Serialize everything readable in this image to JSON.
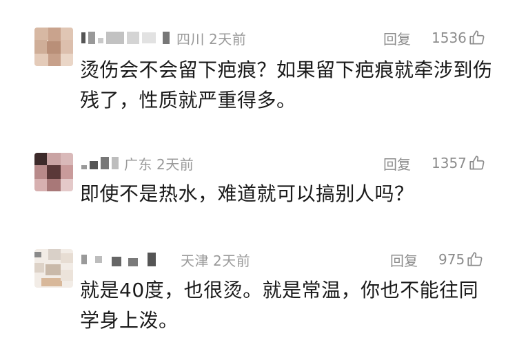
{
  "comments": [
    {
      "location": "四川",
      "time": "2天前",
      "reply_label": "回复",
      "likes": "1536",
      "text": "烫伤会不会留下疤痕？如果留下疤痕就牵涉到伤残了，性质就严重得多。"
    },
    {
      "location": "广东",
      "time": "2天前",
      "reply_label": "回复",
      "likes": "1357",
      "text": "即使不是热水，难道就可以搞别人吗？"
    },
    {
      "location": "天津",
      "time": "2天前",
      "reply_label": "回复",
      "likes": "975",
      "text": "就是40度，也很烫。就是常温，你也不能往同学身上泼。"
    }
  ],
  "icons": {
    "like": "thumbs-up-icon"
  },
  "colors": {
    "meta_text": "#9a9a9a",
    "content_text": "#1a1a1a",
    "blur_block": "#bfbfbf"
  }
}
